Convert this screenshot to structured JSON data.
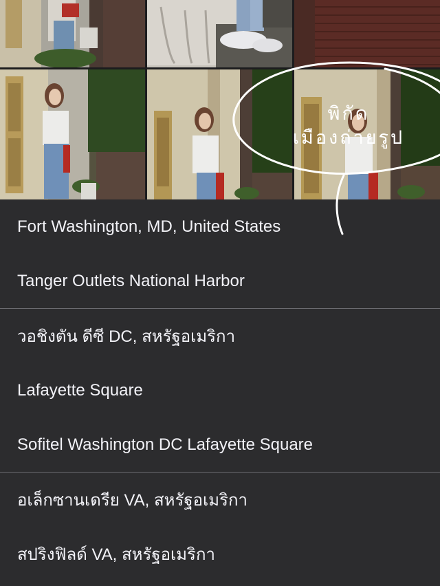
{
  "annotation": {
    "line1": "พิกัด",
    "line2": "เมืองถ่ายรูป"
  },
  "photos": [
    {
      "name": "photo-top-left",
      "subject": "woman-leaning-on-wall"
    },
    {
      "name": "photo-top-middle",
      "subject": "sneakers-on-stone-step"
    },
    {
      "name": "photo-top-right",
      "subject": "brick-sidewalk"
    },
    {
      "name": "photo-bottom-left",
      "subject": "woman-leaning-on-wall"
    },
    {
      "name": "photo-bottom-middle",
      "subject": "woman-leaning-on-wall"
    },
    {
      "name": "photo-bottom-right",
      "subject": "woman-leaning-on-wall"
    }
  ],
  "location_groups": [
    {
      "items": [
        {
          "label": "Fort Washington, MD, United States"
        },
        {
          "label": "Tanger Outlets National Harbor"
        }
      ]
    },
    {
      "items": [
        {
          "label": "วอชิงตัน ดีซี DC, สหรัฐอเมริกา"
        },
        {
          "label": "Lafayette Square"
        },
        {
          "label": "Sofitel Washington DC Lafayette Square"
        }
      ]
    },
    {
      "items": [
        {
          "label": "อเล็กซานเดรีย VA, สหรัฐอเมริกา"
        },
        {
          "label": "สปริงฟิลด์ VA, สหรัฐอเมริกา"
        }
      ]
    }
  ],
  "colors": {
    "list_background": "#2c2c2e",
    "list_text": "#f2f2f7",
    "separator": "#6b6b70",
    "annotation": "#ffffff"
  }
}
